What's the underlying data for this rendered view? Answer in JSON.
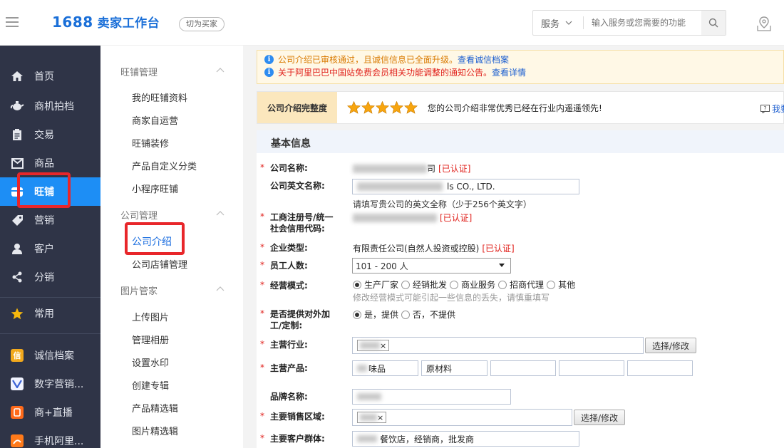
{
  "header": {
    "logo_main": "1688",
    "logo_sub": "卖家工作台",
    "switch_label": "切为买家",
    "search_category": "服务",
    "search_placeholder": "输入服务或您需要的功能"
  },
  "sidebar": {
    "items": [
      {
        "label": "首页",
        "icon": "home-icon"
      },
      {
        "label": "商机拍档",
        "icon": "teapot-icon"
      },
      {
        "label": "交易",
        "icon": "clipboard-icon"
      },
      {
        "label": "商品",
        "icon": "box-icon"
      },
      {
        "label": "旺铺",
        "icon": "shop-icon"
      },
      {
        "label": "营销",
        "icon": "tag-icon"
      },
      {
        "label": "客户",
        "icon": "user-icon"
      },
      {
        "label": "分销",
        "icon": "network-icon"
      },
      {
        "label": "常用",
        "icon": "star-icon"
      },
      {
        "label": "诚信档案",
        "icon": "credit-icon"
      },
      {
        "label": "数字营销...",
        "icon": "digital-marketing-icon"
      },
      {
        "label": "商+直播",
        "icon": "live-icon"
      },
      {
        "label": "手机阿里...",
        "icon": "mobile-ali-icon"
      }
    ],
    "active_label": "旺铺"
  },
  "subnav": {
    "groups": [
      {
        "title": "旺铺管理",
        "links": [
          "我的旺铺资料",
          "商家自运营",
          "旺铺装修",
          "产品自定义分类",
          "小程序旺铺"
        ]
      },
      {
        "title": "公司管理",
        "links": [
          "公司介绍",
          "公司店铺管理"
        ]
      },
      {
        "title": "图片管家",
        "links": [
          "上传图片",
          "管理相册",
          "设置水印",
          "创建专辑",
          "产品精选辑",
          "图片精选辑"
        ]
      }
    ],
    "active_link": "公司介绍"
  },
  "notices": [
    {
      "text": "公司介绍已审核通过，且诚信信息已全面升级。",
      "link": "查看诚信档案"
    },
    {
      "text": "关于阿里巴巴中国站免费会员相关功能调整的通知公告。",
      "link": "查看详情"
    }
  ],
  "completeness": {
    "label": "公司介绍完整度",
    "stars": 5,
    "stars_max": 5,
    "message": "您的公司介绍非常优秀已经在行业内遥遥领先!",
    "feedback": "我要"
  },
  "form": {
    "section_title": "基本信息",
    "certified": "[已认证]",
    "company_name": {
      "label": "公司名称:",
      "value_suffix": "司"
    },
    "company_en": {
      "label": "公司英文名称:",
      "value_suffix": "ls CO., LTD.",
      "hint": "请填写贵公司的英文全称（少于256个英文字）"
    },
    "reg_no": {
      "label_line1": "工商注册号/统一",
      "label_line2": "社会信用代码:"
    },
    "company_type": {
      "label": "企业类型:",
      "value": "有限责任公司(自然人投资或控股)"
    },
    "employees": {
      "label": "员工人数:",
      "value": "101 - 200 人"
    },
    "business_mode": {
      "label": "经营模式:",
      "options": [
        "生产厂家",
        "经销批发",
        "商业服务",
        "招商代理",
        "其他"
      ],
      "selected": "生产厂家",
      "hint": "修改经营模式可能引起一些信息的丢失，请慎重填写"
    },
    "oem": {
      "label_line1": "是否提供对外加",
      "label_line2": "工/定制:",
      "options": [
        "是，提供",
        "否，不提供"
      ],
      "selected": "是，提供"
    },
    "main_industry": {
      "label": "主营行业:",
      "button": "选择/修改"
    },
    "main_products": {
      "label": "主营产品:",
      "values": [
        "味品",
        "原材料",
        "",
        "",
        ""
      ]
    },
    "brand": {
      "label": "品牌名称:"
    },
    "sales_area": {
      "label": "主要销售区域:",
      "button": "选择/修改"
    },
    "customers": {
      "label": "主要客户群体:",
      "value": "餐饮店，经销商，批发商"
    }
  }
}
